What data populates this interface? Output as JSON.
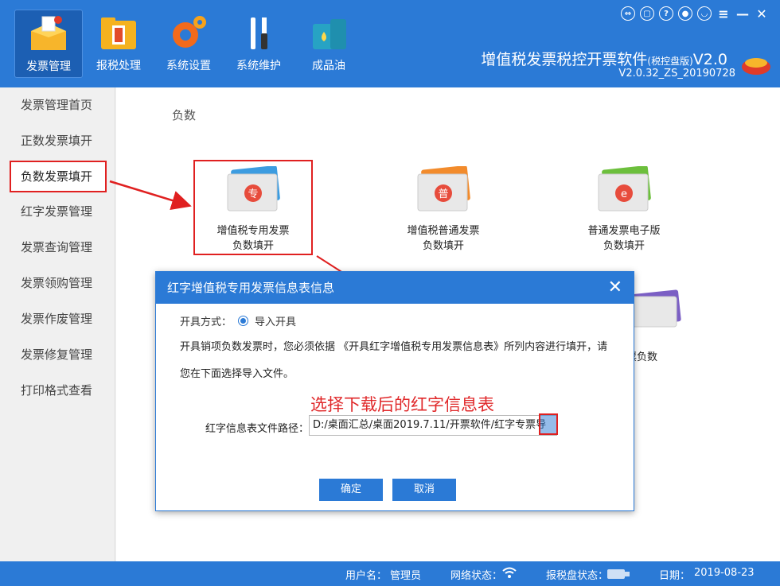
{
  "nav": [
    {
      "label": "发票管理",
      "icon": "invoice-box-icon"
    },
    {
      "label": "报税处理",
      "icon": "tax-folder-icon"
    },
    {
      "label": "系统设置",
      "icon": "gear-icon"
    },
    {
      "label": "系统维护",
      "icon": "wrench-screwdriver-icon"
    },
    {
      "label": "成品油",
      "icon": "oil-can-icon"
    }
  ],
  "window_controls": [
    "switch-icon",
    "copy-icon",
    "help-icon",
    "lock-icon",
    "user-icon",
    "menu-icon",
    "minimize-icon",
    "close-icon"
  ],
  "app": {
    "title": "增值税发票税控开票软件",
    "edition": "(税控盘版)",
    "version_suffix": "V2.0",
    "build": "V2.0.32_ZS_20190728"
  },
  "sidebar": [
    {
      "label": "发票管理首页"
    },
    {
      "label": "正数发票填开"
    },
    {
      "label": "负数发票填开"
    },
    {
      "label": "红字发票管理"
    },
    {
      "label": "发票查询管理"
    },
    {
      "label": "发票领购管理"
    },
    {
      "label": "发票作废管理"
    },
    {
      "label": "发票修复管理"
    },
    {
      "label": "打印格式查看"
    }
  ],
  "main": {
    "section_title": "负数",
    "invoices": [
      {
        "line1": "增值税专用发票",
        "line2": "负数填开",
        "badge": "专"
      },
      {
        "line1": "增值税普通发票",
        "line2": "负数填开",
        "badge": "普"
      },
      {
        "line1": "普通发票电子版",
        "line2": "负数填开",
        "badge": "e"
      }
    ],
    "partial_label": "票负数"
  },
  "dialog": {
    "title": "红字增值税专用发票信息表信息",
    "mode_label": "开具方式：",
    "mode_value": "导入开具",
    "desc_line1": "开具销项负数发票时，您必须依据 《开具红字增值税专用发票信息表》所列内容进行填开，请",
    "desc_line2": "您在下面选择导入文件。",
    "path_label": "红字信息表文件路径：",
    "path_value": "D:/桌面汇总/桌面2019.7.11/开票软件/红字专票导",
    "ok": "确定",
    "cancel": "取消"
  },
  "annotation": "选择下载后的红字信息表",
  "status": {
    "user_label": "用户名：",
    "user": "管理员",
    "network_label": "网络状态：",
    "disk_label": "报税盘状态：",
    "date_label": "日期：",
    "date": "2019-08-23"
  },
  "colors": {
    "primary": "#2b7ad6",
    "highlight": "#e02020"
  }
}
